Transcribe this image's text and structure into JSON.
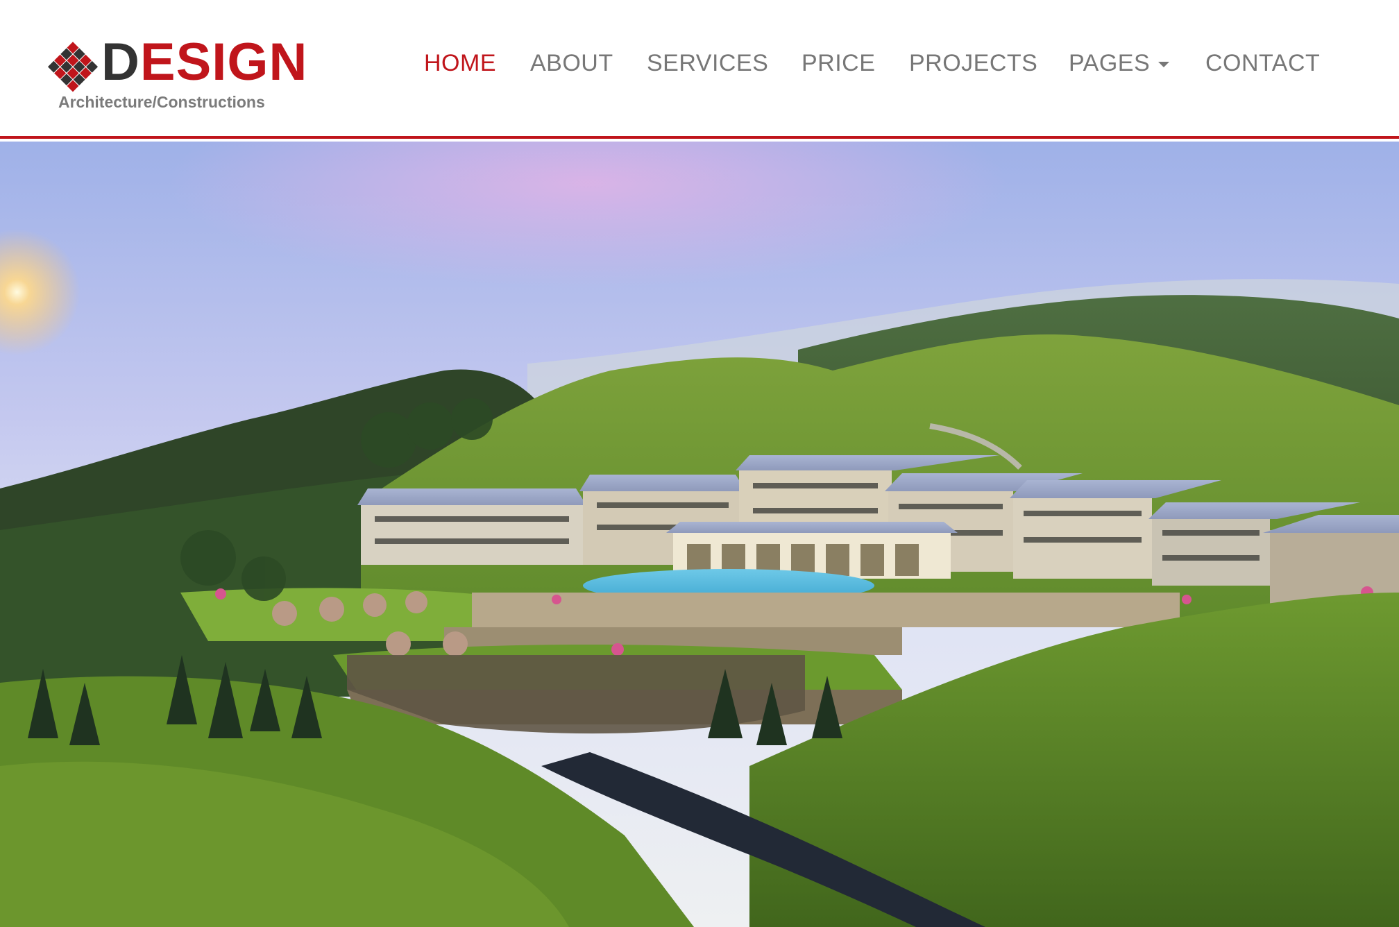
{
  "brand": {
    "logo_text": "DESIGN",
    "tagline": "Architecture/Constructions",
    "accent_color": "#c0151b"
  },
  "nav": {
    "home": "HOME",
    "about": "ABOUT",
    "services": "SERVICES",
    "price": "PRICE",
    "projects": "PROJECTS",
    "pages": "PAGES",
    "contact": "CONTACT",
    "active_item": "HOME",
    "pages_icon": "caret-down-icon"
  },
  "hero": {
    "image_subject": "resort-on-hillside-rendering"
  }
}
